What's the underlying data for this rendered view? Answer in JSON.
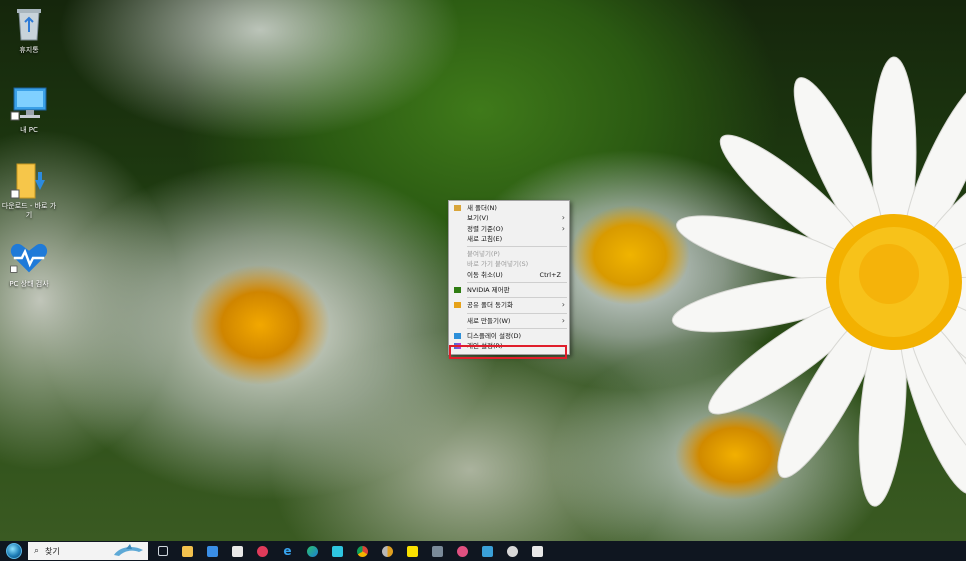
{
  "desktop_icons": [
    {
      "label": "휴지통",
      "icon": "recycle-bin-icon"
    },
    {
      "label": "내 PC",
      "icon": "this-pc-icon"
    },
    {
      "label": "다운로드 - 바로 가기",
      "icon": "downloads-folder-icon"
    },
    {
      "label": "PC 상태 검사",
      "icon": "pc-health-check-icon"
    }
  ],
  "context_menu": {
    "items": [
      {
        "label": "새 폴더(N)",
        "icon": "new-folder-icon"
      },
      {
        "label": "보기(V)",
        "submenu": true
      },
      {
        "label": "정렬 기준(O)",
        "submenu": true
      },
      {
        "label": "새로 고침(E)"
      },
      {
        "label": "붙여넣기(P)",
        "disabled": true
      },
      {
        "label": "바로 가기 붙여넣기(S)",
        "disabled": true
      },
      {
        "label": "이동 취소(U)",
        "shortcut": "Ctrl+Z"
      },
      {
        "label": "NVIDIA 제어판",
        "icon": "nvidia-icon"
      },
      {
        "label": "공유 폴더 동기화",
        "icon": "sync-folder-icon",
        "submenu": true
      },
      {
        "label": "새로 만들기(W)",
        "submenu": true
      },
      {
        "label": "디스플레이 설정(D)",
        "icon": "display-icon"
      },
      {
        "label": "개인 설정(R)",
        "icon": "personalize-icon",
        "highlighted": true
      }
    ]
  },
  "taskbar": {
    "search_placeholder": "찾기",
    "apps": [
      "task-view-icon",
      "file-explorer-icon",
      "store-icon",
      "photos-icon",
      "record-app-icon",
      "internet-explorer-icon",
      "edge-icon",
      "bird-app-icon",
      "chrome-icon",
      "chrome-canary-icon",
      "kakaotalk-icon",
      "calculator-icon",
      "media-app-icon",
      "network-app-icon",
      "audio-app-icon",
      "printer-icon"
    ]
  },
  "colors": {
    "highlight_border": "#e01e2b",
    "taskbar_bg": "#0f1620"
  }
}
